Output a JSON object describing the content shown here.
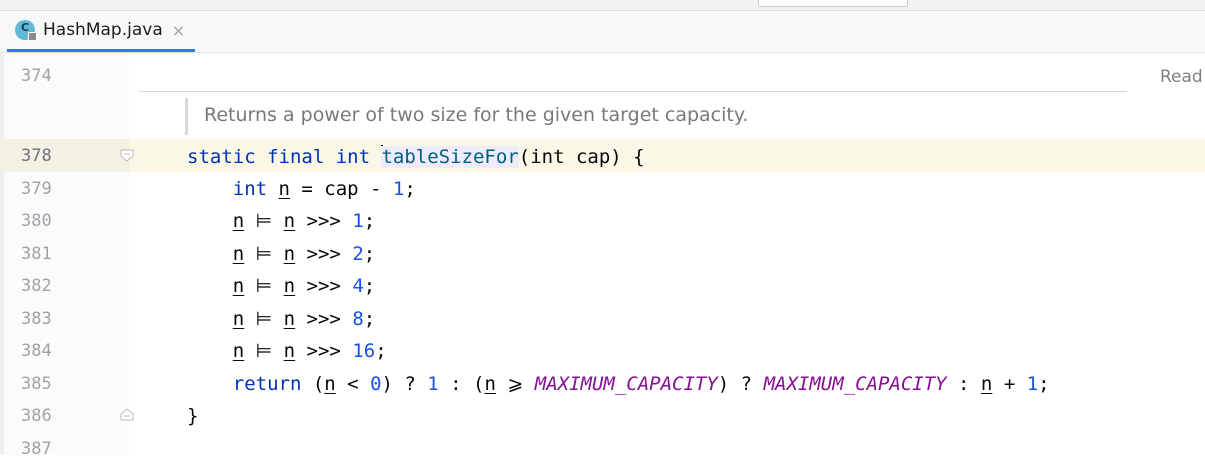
{
  "tab": {
    "icon_letter": "C",
    "label": "HashMap.java",
    "close": "×",
    "icon": "java-class-icon"
  },
  "editor": {
    "reader_mode_label": "Read",
    "doc_comment": "Returns a power of two size for the given target capacity.",
    "line_numbers": {
      "l374": "374",
      "l378": "378",
      "l379": "379",
      "l380": "380",
      "l381": "381",
      "l382": "382",
      "l383": "383",
      "l384": "384",
      "l385": "385",
      "l386": "386",
      "l387": "387"
    },
    "code": {
      "l378": {
        "t1": "static final int ",
        "t2": "tableSizeFor",
        "t3": "(int cap) {"
      },
      "l379": {
        "t1": "    int ",
        "t2": "n",
        "t3": " = cap - ",
        "t4": "1",
        "t5": ";"
      },
      "l380": {
        "t1": "    ",
        "t2": "n",
        "t3": " ⊨ ",
        "t4": "n",
        "t5": " >>> ",
        "t6": "1",
        "t7": ";"
      },
      "l381": {
        "t1": "    ",
        "t2": "n",
        "t3": " ⊨ ",
        "t4": "n",
        "t5": " >>> ",
        "t6": "2",
        "t7": ";"
      },
      "l382": {
        "t1": "    ",
        "t2": "n",
        "t3": " ⊨ ",
        "t4": "n",
        "t5": " >>> ",
        "t6": "4",
        "t7": ";"
      },
      "l383": {
        "t1": "    ",
        "t2": "n",
        "t3": " ⊨ ",
        "t4": "n",
        "t5": " >>> ",
        "t6": "8",
        "t7": ";"
      },
      "l384": {
        "t1": "    ",
        "t2": "n",
        "t3": " ⊨ ",
        "t4": "n",
        "t5": " >>> ",
        "t6": "16",
        "t7": ";"
      },
      "l385": {
        "t1": "    return",
        "t2": " (",
        "t3": "n",
        "t4": " < ",
        "t5": "0",
        "t6": ") ? ",
        "t7": "1",
        "t8": " : (",
        "t9": "n",
        "t10": " ⩾ ",
        "t11": "MAXIMUM_CAPACITY",
        "t12": ") ? ",
        "t13": "MAXIMUM_CAPACITY",
        "t14": " : ",
        "t15": "n",
        "t16": " + ",
        "t17": "1",
        "t18": ";"
      },
      "l386": {
        "t1": "}"
      }
    }
  },
  "colors": {
    "keyword": "#0033b3",
    "number": "#1750eb",
    "constant": "#871094",
    "method": "#00627a",
    "tab_underline": "#3574f0"
  }
}
